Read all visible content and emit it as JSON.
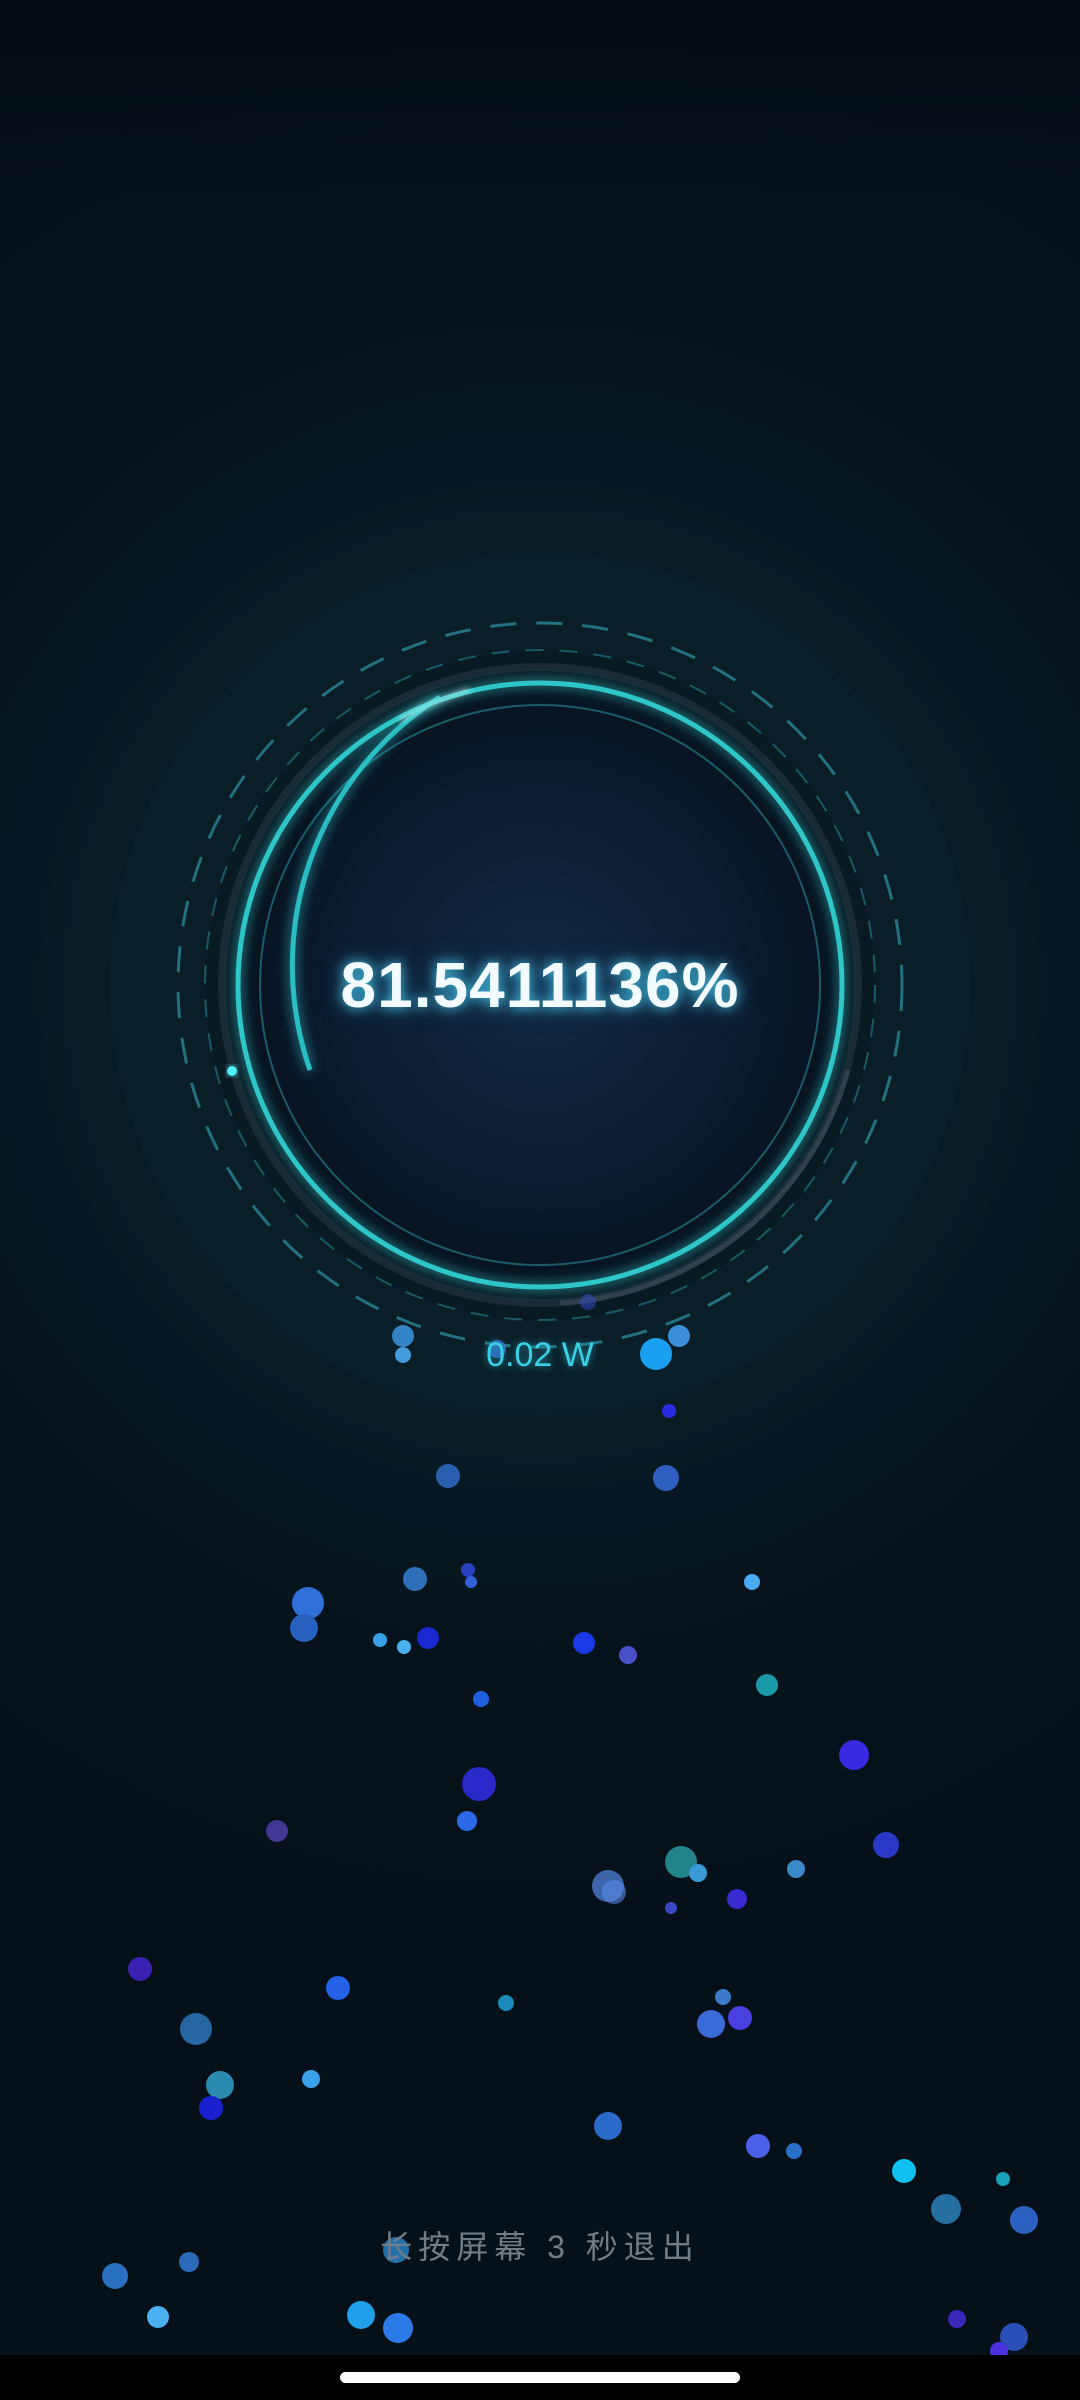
{
  "charge": {
    "percent_text": "81.5411136%",
    "level_percent": 81.54,
    "power_text": "0.02 W"
  },
  "hint": {
    "exit_text": "长按屏幕 3 秒退出"
  },
  "colors": {
    "ring": "#2ec6c8",
    "dash": "#2a8f9c",
    "text_glow": "#50dcff",
    "power": "#39d0e8",
    "background": "#061019"
  },
  "icons": {
    "particles": "bubble-particles"
  }
}
